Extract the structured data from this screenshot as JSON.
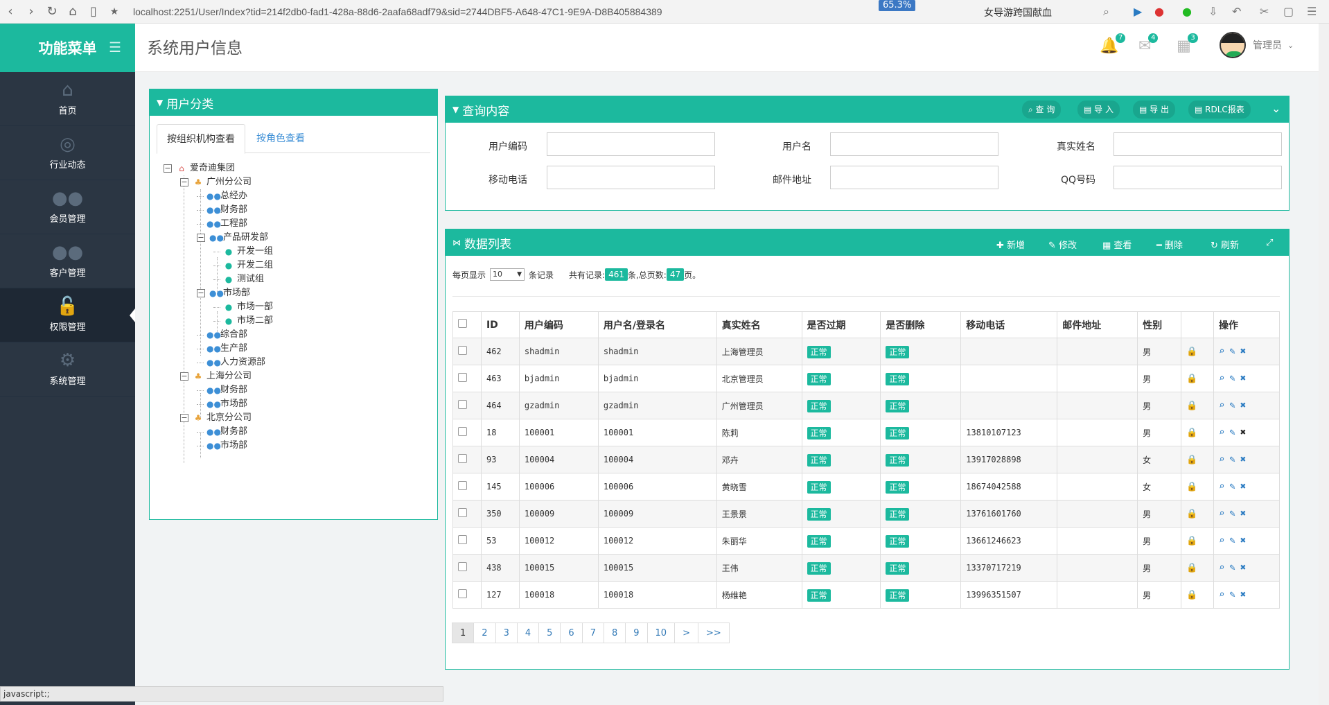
{
  "browser": {
    "url": "localhost:2251/User/Index?tid=214f2db0-fad1-428a-88d6-2aafa68adf79&sid=2744DBF5-A648-47C1-9E9A-D8B405884389",
    "zoom": "65.3%",
    "search_text": "女导游跨国献血"
  },
  "sidebar": {
    "brand": "功能菜单",
    "items": [
      {
        "label": "首页",
        "icon": "home-icon"
      },
      {
        "label": "行业动态",
        "icon": "globe-icon"
      },
      {
        "label": "会员管理",
        "icon": "users-icon"
      },
      {
        "label": "客户管理",
        "icon": "users-icon"
      },
      {
        "label": "权限管理",
        "icon": "lock-icon"
      },
      {
        "label": "系统管理",
        "icon": "gear-icon"
      }
    ],
    "active": "权限管理"
  },
  "header": {
    "title": "系统用户信息",
    "notif_count": "7",
    "mail_count": "4",
    "task_count": "3",
    "username": "管理员"
  },
  "category_panel": {
    "title": "用户分类",
    "tab_org": "按组织机构查看",
    "tab_role": "按角色查看",
    "tree": [
      {
        "label": "爱奇迪集团",
        "level": 0,
        "type": "root",
        "expanded": true
      },
      {
        "label": "广州分公司",
        "level": 1,
        "type": "org",
        "expanded": true
      },
      {
        "label": "总经办",
        "level": 2,
        "type": "dept"
      },
      {
        "label": "财务部",
        "level": 2,
        "type": "dept"
      },
      {
        "label": "工程部",
        "level": 2,
        "type": "dept"
      },
      {
        "label": "产品研发部",
        "level": 2,
        "type": "dept",
        "expanded": true
      },
      {
        "label": "开发一组",
        "level": 3,
        "type": "group"
      },
      {
        "label": "开发二组",
        "level": 3,
        "type": "group"
      },
      {
        "label": "测试组",
        "level": 3,
        "type": "group"
      },
      {
        "label": "市场部",
        "level": 2,
        "type": "dept",
        "expanded": true
      },
      {
        "label": "市场一部",
        "level": 3,
        "type": "group"
      },
      {
        "label": "市场二部",
        "level": 3,
        "type": "group"
      },
      {
        "label": "综合部",
        "level": 2,
        "type": "dept"
      },
      {
        "label": "生产部",
        "level": 2,
        "type": "dept"
      },
      {
        "label": "人力资源部",
        "level": 2,
        "type": "dept"
      },
      {
        "label": "上海分公司",
        "level": 1,
        "type": "org",
        "expanded": true
      },
      {
        "label": "财务部",
        "level": 2,
        "type": "dept"
      },
      {
        "label": "市场部",
        "level": 2,
        "type": "dept"
      },
      {
        "label": "北京分公司",
        "level": 1,
        "type": "org",
        "expanded": true
      },
      {
        "label": "财务部",
        "level": 2,
        "type": "dept"
      },
      {
        "label": "市场部",
        "level": 2,
        "type": "dept"
      }
    ]
  },
  "query_panel": {
    "title": "查询内容",
    "buttons": {
      "search": "查 询",
      "import": "导 入",
      "export": "导 出",
      "rdlc": "RDLC报表"
    },
    "fields": {
      "user_code": "用户编码",
      "user_name": "用户名",
      "real_name": "真实姓名",
      "mobile": "移动电话",
      "email": "邮件地址",
      "qq": "QQ号码"
    }
  },
  "data_panel": {
    "title": "数据列表",
    "toolbar": {
      "add": "新增",
      "edit": "修改",
      "view": "查看",
      "delete": "删除",
      "refresh": "刷新"
    },
    "page_size_label": "每页显示",
    "page_size": "10",
    "records_label": "条记录",
    "total_prefix": "共有记录:",
    "total_records": "461",
    "total_mid": "条,总页数:",
    "total_pages": "47",
    "total_suffix": "页。",
    "columns": [
      "ID",
      "用户编码",
      "用户名/登录名",
      "真实姓名",
      "是否过期",
      "是否删除",
      "移动电话",
      "邮件地址",
      "性别",
      "",
      "操作"
    ],
    "rows": [
      {
        "id": "462",
        "code": "shadmin",
        "login": "shadmin",
        "name": "上海管理员",
        "expired": "正常",
        "deleted": "正常",
        "mobile": "",
        "email": "",
        "gender": "男"
      },
      {
        "id": "463",
        "code": "bjadmin",
        "login": "bjadmin",
        "name": "北京管理员",
        "expired": "正常",
        "deleted": "正常",
        "mobile": "",
        "email": "",
        "gender": "男"
      },
      {
        "id": "464",
        "code": "gzadmin",
        "login": "gzadmin",
        "name": "广州管理员",
        "expired": "正常",
        "deleted": "正常",
        "mobile": "",
        "email": "",
        "gender": "男"
      },
      {
        "id": "18",
        "code": "100001",
        "login": "100001",
        "name": "陈莉",
        "expired": "正常",
        "deleted": "正常",
        "mobile": "13810107123",
        "email": "",
        "gender": "男"
      },
      {
        "id": "93",
        "code": "100004",
        "login": "100004",
        "name": "邓卉",
        "expired": "正常",
        "deleted": "正常",
        "mobile": "13917028898",
        "email": "",
        "gender": "女"
      },
      {
        "id": "145",
        "code": "100006",
        "login": "100006",
        "name": "黄晓雪",
        "expired": "正常",
        "deleted": "正常",
        "mobile": "18674042588",
        "email": "",
        "gender": "女"
      },
      {
        "id": "350",
        "code": "100009",
        "login": "100009",
        "name": "王景景",
        "expired": "正常",
        "deleted": "正常",
        "mobile": "13761601760",
        "email": "",
        "gender": "男"
      },
      {
        "id": "53",
        "code": "100012",
        "login": "100012",
        "name": "朱丽华",
        "expired": "正常",
        "deleted": "正常",
        "mobile": "13661246623",
        "email": "",
        "gender": "男"
      },
      {
        "id": "438",
        "code": "100015",
        "login": "100015",
        "name": "王伟",
        "expired": "正常",
        "deleted": "正常",
        "mobile": "13370717219",
        "email": "",
        "gender": "男"
      },
      {
        "id": "127",
        "code": "100018",
        "login": "100018",
        "name": "杨维艳",
        "expired": "正常",
        "deleted": "正常",
        "mobile": "13996351507",
        "email": "",
        "gender": "男"
      }
    ],
    "pages": [
      "1",
      "2",
      "3",
      "4",
      "5",
      "6",
      "7",
      "8",
      "9",
      "10",
      ">",
      ">>"
    ]
  },
  "statusbar": "javascript:;",
  "colors": {
    "accent": "#1cb99e",
    "sidebar": "#2b3643",
    "link": "#2a7bc2"
  }
}
